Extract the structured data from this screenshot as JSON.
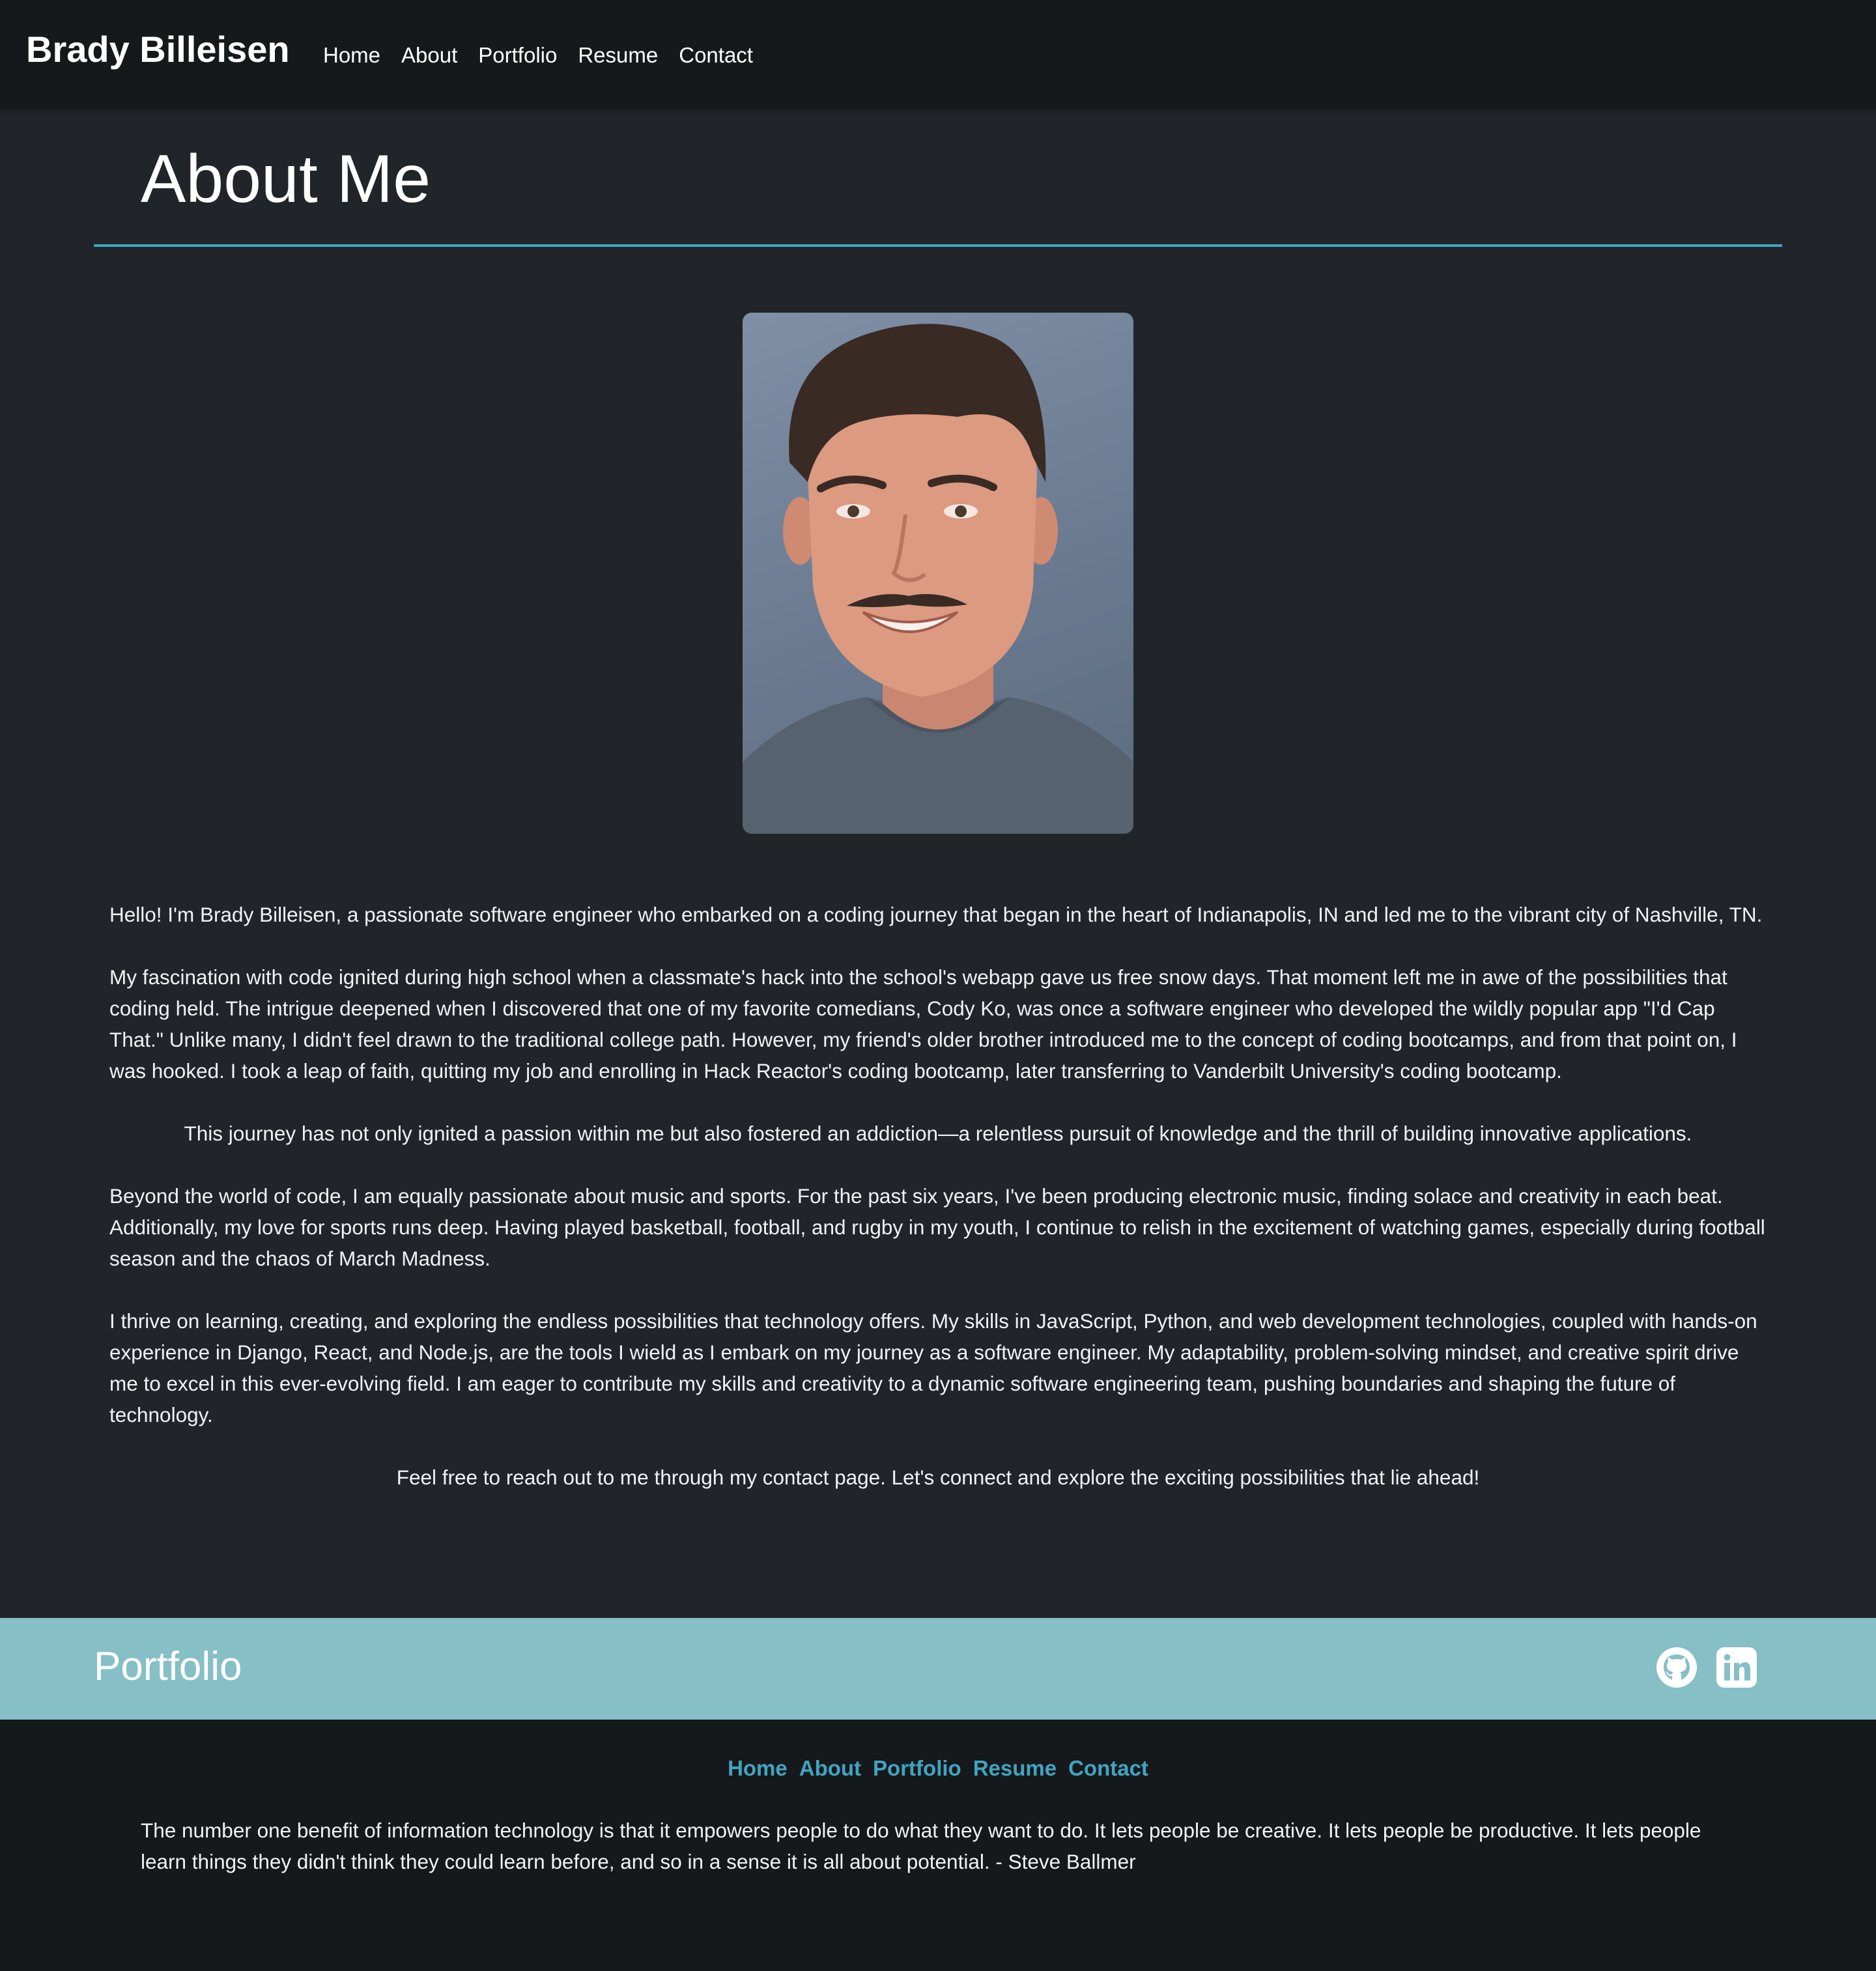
{
  "nav": {
    "brand": "Brady Billeisen",
    "links": [
      "Home",
      "About",
      "Portfolio",
      "Resume",
      "Contact"
    ]
  },
  "page": {
    "title": "About Me"
  },
  "paragraphs": [
    "Hello! I'm Brady Billeisen, a passionate software engineer who embarked on a coding journey that began in the heart of Indianapolis, IN and led me to the vibrant city of Nashville, TN.",
    "My fascination with code ignited during high school when a classmate's hack into the school's webapp gave us free snow days. That moment left me in awe of the possibilities that coding held. The intrigue deepened when I discovered that one of my favorite comedians, Cody Ko, was once a software engineer who developed the wildly popular app \"I'd Cap That.\" Unlike many, I didn't feel drawn to the traditional college path. However, my friend's older brother introduced me to the concept of coding bootcamps, and from that point on, I was hooked. I took a leap of faith, quitting my job and enrolling in Hack Reactor's coding bootcamp, later transferring to Vanderbilt University's coding bootcamp.",
    "This journey has not only ignited a passion within me but also fostered an addiction—a relentless pursuit of knowledge and the thrill of building innovative applications.",
    "Beyond the world of code, I am equally passionate about music and sports. For the past six years, I've been producing electronic music, finding solace and creativity in each beat. Additionally, my love for sports runs deep. Having played basketball, football, and rugby in my youth, I continue to relish in the excitement of watching games, especially during football season and the chaos of March Madness.",
    "I thrive on learning, creating, and exploring the endless possibilities that technology offers. My skills in JavaScript, Python, and web development technologies, coupled with hands-on experience in Django, React, and Node.js, are the tools I wield as I embark on my journey as a software engineer. My adaptability, problem-solving mindset, and creative spirit drive me to excel in this ever-evolving field. I am eager to contribute my skills and creativity to a dynamic software engineering team, pushing boundaries and shaping the future of technology.",
    "Feel free to reach out to me through my contact page. Let's connect and explore the exciting possibilities that lie ahead!"
  ],
  "band": {
    "title": "Portfolio",
    "icons": [
      "github-icon",
      "linkedin-icon"
    ]
  },
  "footer": {
    "links": [
      "Home",
      "About",
      "Portfolio",
      "Resume",
      "Contact"
    ],
    "quote": "The number one benefit of information technology is that it empowers people to do what they want to do. It lets people be creative. It lets people be productive. It lets people learn things they didn't think they could learn before, and so in a sense it is all about potential. - Steve Ballmer"
  },
  "colors": {
    "page_bg": "#212529",
    "nav_bg": "#16191c",
    "accent": "#3fa5c2",
    "band_bg": "#86bfc6"
  }
}
